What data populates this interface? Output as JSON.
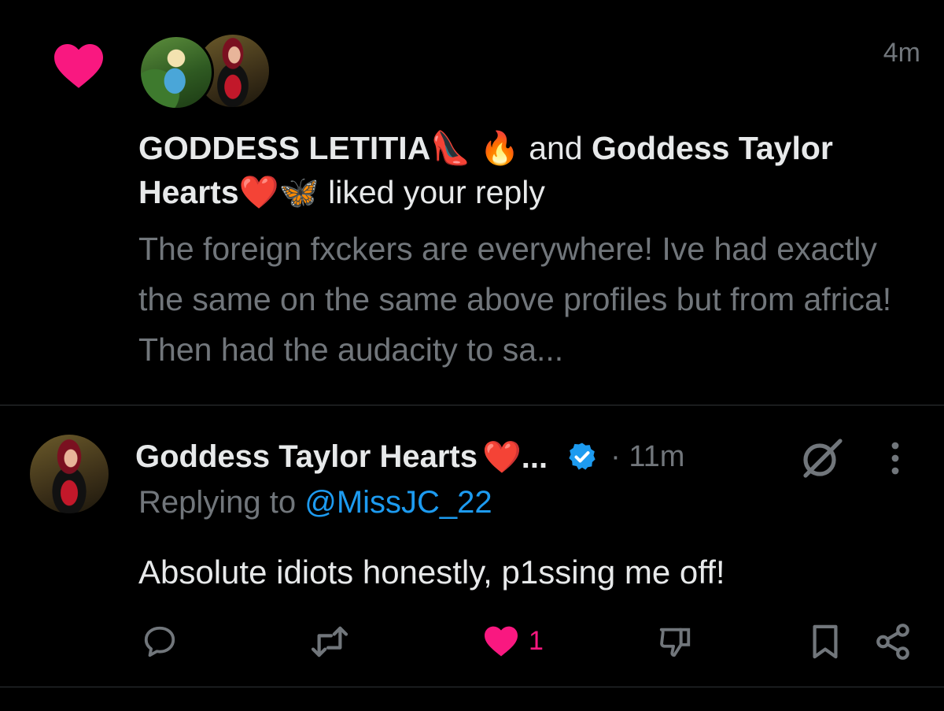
{
  "colors": {
    "background": "#000000",
    "text_primary": "#e7e9ea",
    "text_secondary": "#71767b",
    "like_pink": "#f91880",
    "link_blue": "#1d9bf0",
    "divider": "#2f3336"
  },
  "notification": {
    "icon": "heart-icon",
    "timestamp": "4m",
    "liker_1": "GODDESS LETITIA",
    "liker_1_emoji": "👠 🔥",
    "connector": " and ",
    "liker_2": "Goddess Taylor Hearts",
    "liker_2_emoji": "❤️🦋",
    "action_text": " liked your reply",
    "preview": "The foreign fxckers are everywhere! Ive had exactly the same on the same above profiles but from africa! Then had the audacity to sa..."
  },
  "reply_tweet": {
    "author_name": "Goddess Taylor Hearts",
    "author_emoji": "❤️...",
    "verified_icon": "verified-badge-icon",
    "time": "· 11m",
    "replying_prefix": "Replying to ",
    "replying_handle": "@MissJC_22",
    "body": "Absolute idiots honestly, p1ssing me off!",
    "actions": {
      "reply_icon": "reply-icon",
      "retweet_icon": "retweet-icon",
      "like_icon": "heart-icon",
      "like_count": "1",
      "dislike_icon": "dislike-icon",
      "bookmark_icon": "bookmark-icon",
      "share_icon": "share-icon"
    }
  }
}
